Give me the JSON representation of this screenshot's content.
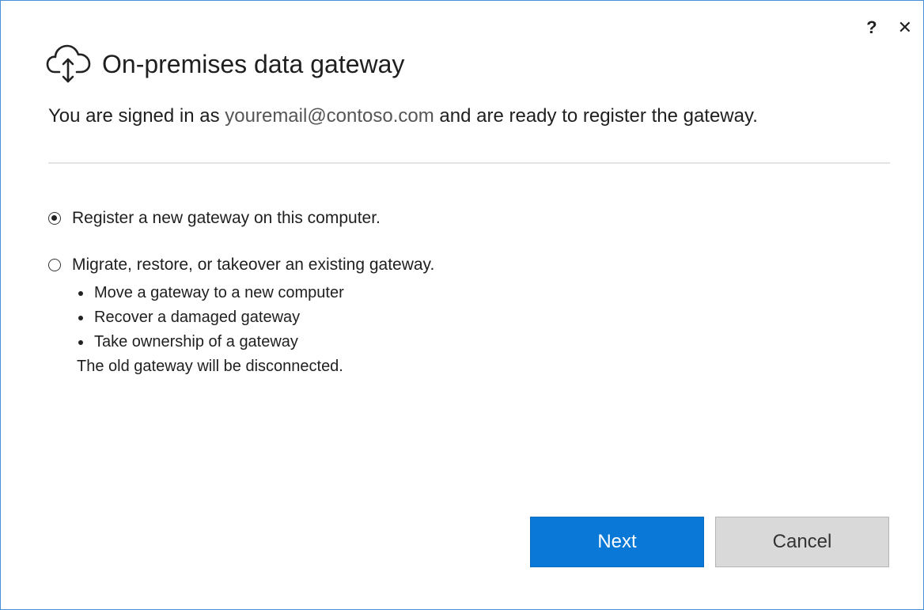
{
  "window": {
    "help_label": "?",
    "close_label": "✕"
  },
  "header": {
    "icon": "cloud-upload-icon",
    "title": "On-premises data gateway"
  },
  "signin": {
    "prefix": "You are signed in as ",
    "email": "youremail@contoso.com",
    "suffix": " and are ready to register the gateway."
  },
  "options": {
    "register": {
      "label": "Register a new gateway on this computer.",
      "selected": true
    },
    "migrate": {
      "label": "Migrate, restore, or takeover an existing gateway.",
      "selected": false,
      "bullets": [
        "Move a gateway to a new computer",
        "Recover a damaged gateway",
        "Take ownership of a gateway"
      ],
      "note": "The old gateway will be disconnected."
    }
  },
  "buttons": {
    "next": "Next",
    "cancel": "Cancel"
  },
  "colors": {
    "accent": "#0a78d7",
    "cancel_bg": "#d9d9d9",
    "window_border": "#4a90d9"
  }
}
